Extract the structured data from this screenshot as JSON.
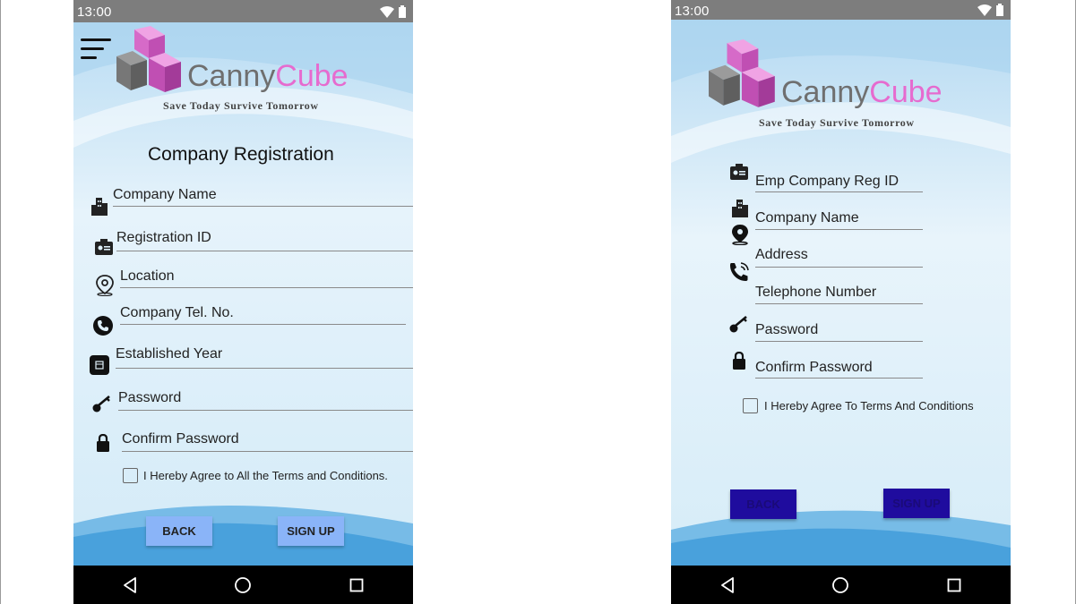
{
  "status_bar": {
    "time": "13:00",
    "icons": [
      "wifi-icon",
      "battery-icon"
    ]
  },
  "brand": {
    "name_part1": "Canny",
    "name_part2": "Cube",
    "tagline": "Save Today Survive Tomorrow"
  },
  "colors": {
    "brand_pink": "#e66bcf",
    "brand_grey": "#6f6f6f",
    "button_light": "#8ab4f8",
    "button_dark": "#1f0c9e"
  },
  "screen_a": {
    "title": "Company Registration",
    "fields": [
      {
        "label": "Company Name",
        "icon": "building-icon"
      },
      {
        "label": "Registration ID",
        "icon": "id-card-icon"
      },
      {
        "label": "Location",
        "icon": "location-pin-icon"
      },
      {
        "label": "Company Tel. No.",
        "icon": "phone-icon"
      },
      {
        "label": "Established Year",
        "icon": "calendar-icon"
      },
      {
        "label": "Password",
        "icon": "key-icon"
      },
      {
        "label": "Confirm Password",
        "icon": "lock-icon"
      }
    ],
    "terms": "I Hereby Agree to All the Terms and Conditions.",
    "back_label": "BACK",
    "signup_label": "SIGN UP"
  },
  "screen_b": {
    "fields": [
      {
        "label": "Emp Company Reg ID",
        "icon": "id-card-icon"
      },
      {
        "label": "Company Name",
        "icon": "building-icon"
      },
      {
        "label": "Address",
        "icon": "location-pin-icon"
      },
      {
        "label": "Telephone Number",
        "icon": "phone-ring-icon"
      },
      {
        "label": "Password",
        "icon": "key-icon"
      },
      {
        "label": "Confirm Password",
        "icon": "lock-icon"
      }
    ],
    "terms": "I Hereby Agree To Terms And Conditions",
    "back_label": "BACK",
    "signup_label": "SIGN UP"
  },
  "nav_bar": [
    "back-triangle-icon",
    "home-circle-icon",
    "recents-square-icon"
  ]
}
